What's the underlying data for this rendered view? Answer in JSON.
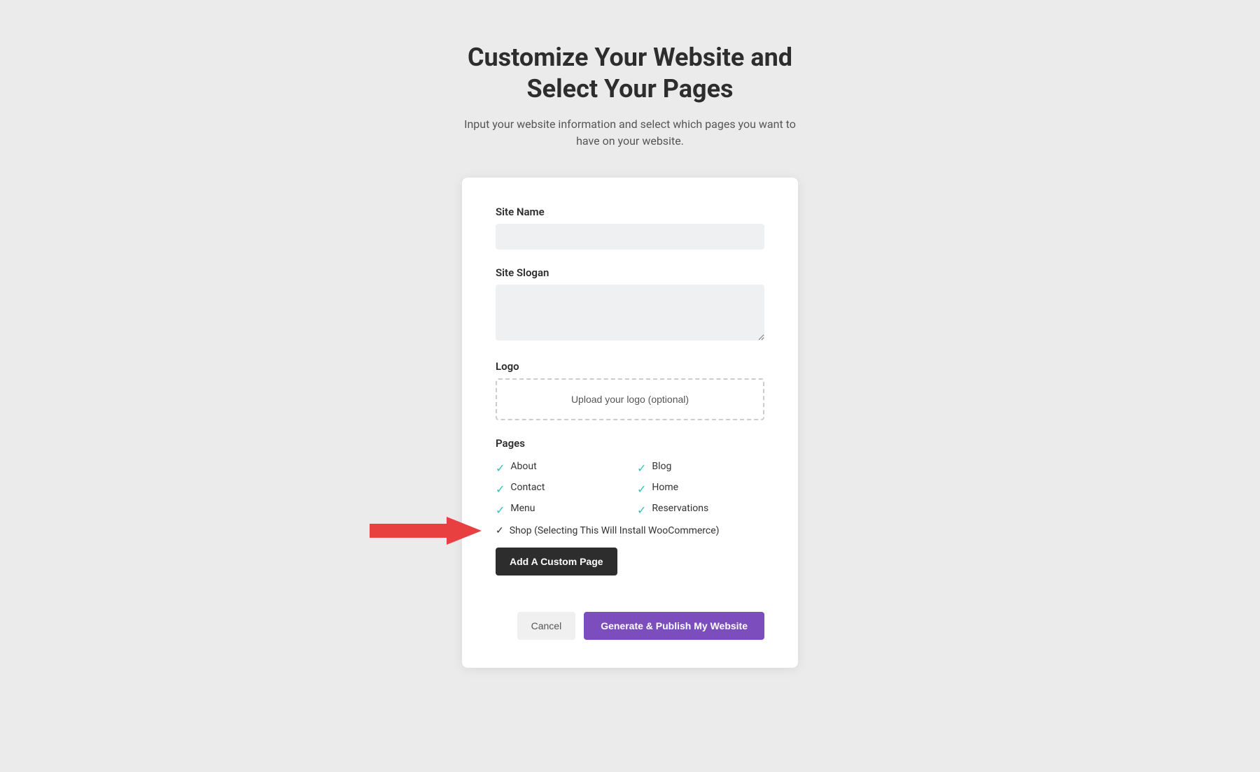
{
  "header": {
    "title_line1": "Customize Your Website and",
    "title_line2": "Select Your Pages",
    "subtitle": "Input your website information and select which pages you want to have on your website."
  },
  "form": {
    "site_name_label": "Site Name",
    "site_name_placeholder": "",
    "site_slogan_label": "Site Slogan",
    "site_slogan_placeholder": "",
    "logo_label": "Logo",
    "logo_upload_text": "Upload your logo (optional)",
    "pages_label": "Pages",
    "pages": [
      {
        "label": "About",
        "checked": true,
        "column": "left"
      },
      {
        "label": "Blog",
        "checked": true,
        "column": "right"
      },
      {
        "label": "Contact",
        "checked": true,
        "column": "left"
      },
      {
        "label": "Home",
        "checked": true,
        "column": "right"
      },
      {
        "label": "Menu",
        "checked": true,
        "column": "left"
      },
      {
        "label": "Reservations",
        "checked": true,
        "column": "right"
      }
    ],
    "shop_page": {
      "label": "Shop (Selecting This Will Install WooCommerce)",
      "checked": true
    },
    "add_custom_page_label": "Add A Custom Page",
    "cancel_label": "Cancel",
    "generate_label": "Generate & Publish My Website"
  },
  "colors": {
    "check": "#2ec4b6",
    "add_btn_bg": "#2d2d2d",
    "generate_btn_bg": "#7c4dbd",
    "arrow": "#e84040"
  }
}
